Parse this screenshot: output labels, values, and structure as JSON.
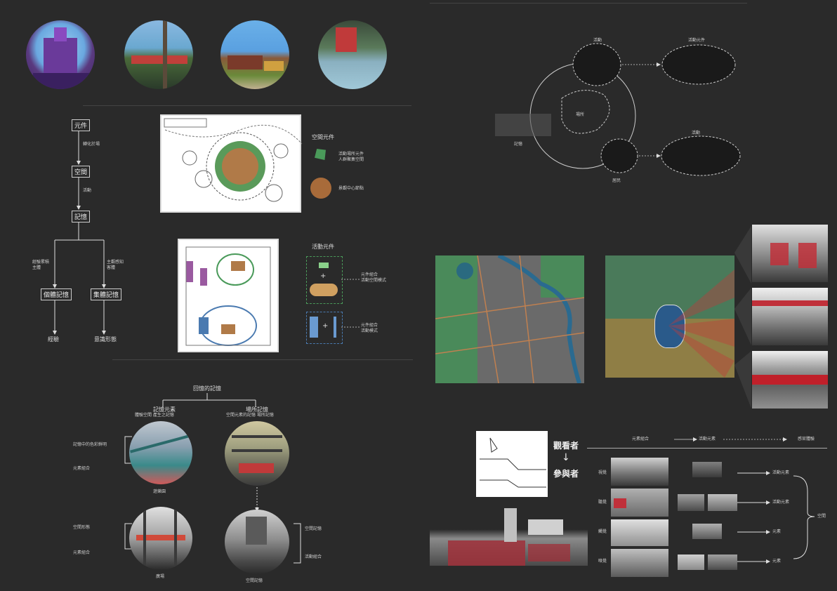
{
  "flowchart": {
    "node_1": "元件",
    "edge_1": "轉化於場",
    "node_2": "空間",
    "edge_2": "活動",
    "node_3": "記憶",
    "branch_left_label": "經驗累積\n主體",
    "branch_right_label": "主觀感知\n客體",
    "node_4_left": "個體記憶",
    "node_4_right": "集體記憶",
    "result_left": "經驗",
    "result_right": "意識形態"
  },
  "plan_legend_top": {
    "title": "空間元件",
    "item_green": "活動場所元件\n人群聚集空間",
    "item_brown": "景觀中心節點"
  },
  "plan_legend_bottom": {
    "title": "活動元件",
    "item_1": "元件組合\n活動空間模式",
    "item_2": "元件組合\n活動模式"
  },
  "memory_section": {
    "title": "回憶的記憶",
    "left_title": "記憶元素",
    "right_title": "場所記憶",
    "left_sub": "體驗空間 產生之記憶",
    "right_sub": "空間元素的記憶 場所記憶",
    "caption_1": "遊樂園",
    "caption_2": "",
    "caption_3": "廣場",
    "caption_4": "空間記憶",
    "note_1a": "記憶中的色彩鮮明",
    "note_1b": "元素組合",
    "note_2a": "空間形態",
    "note_2b": "元素組合",
    "note_3a": "空間記憶",
    "note_3b": "活動組合"
  },
  "cycle_diagram": {
    "top_label": "活動",
    "right_top_label": "活動元件",
    "center_label": "場所",
    "left_label": "記憶",
    "bottom_label": "居民",
    "right_bottom_label": "活動"
  },
  "bottom_right": {
    "observer": "觀看者",
    "arrow": "↓",
    "participant": "參與者",
    "header_1": "元素組合",
    "header_2": "活動元素",
    "header_3": "感官體驗",
    "row_1": "視覺",
    "row_2": "聽覺",
    "row_3": "觸覺",
    "row_4": "嗅覺",
    "out_1": "活動元素",
    "out_2": "活動元素",
    "out_3": "元素",
    "out_4": "元素",
    "bracket_label": "空間"
  },
  "colors": {
    "background": "#2a2a2a",
    "accent_green": "#4a9a5a",
    "accent_brown": "#a86b3a",
    "accent_red": "#c0202a",
    "accent_blue": "#4a7ab0"
  }
}
